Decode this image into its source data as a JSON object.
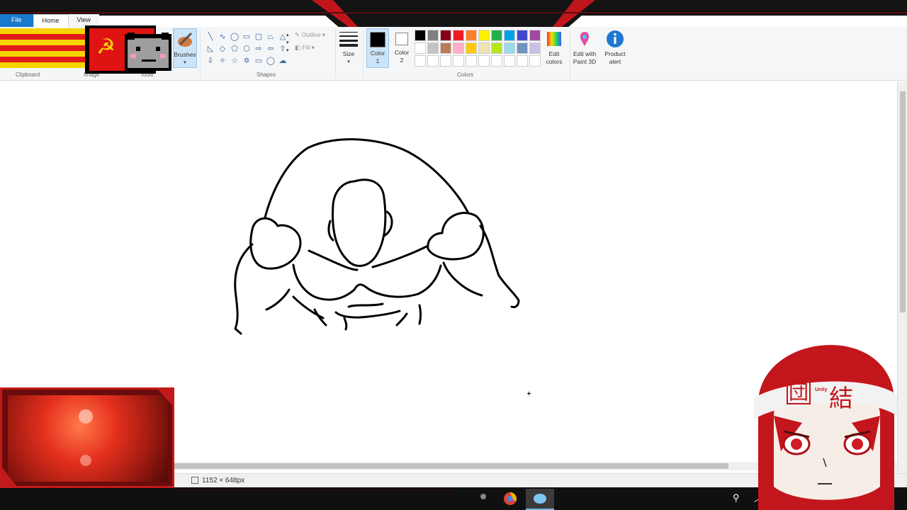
{
  "menu": {
    "file": "File",
    "home": "Home",
    "view": "View"
  },
  "ribbon": {
    "clipboard_label": "Clipboard",
    "image_label": "Image",
    "tools_label": "Tools",
    "brushes_label": "Brushes",
    "shapes_label": "Shapes",
    "outline_label": "Outline",
    "fill_label": "Fill",
    "size_label": "Size",
    "color1_label_a": "Color",
    "color1_label_b": "1",
    "color2_label_a": "Color",
    "color2_label_b": "2",
    "colors_label": "Colors",
    "edit_colors_a": "Edit",
    "edit_colors_b": "colors",
    "edit_3d_a": "Edit with",
    "edit_3d_b": "Paint 3D",
    "product_alert_a": "Product",
    "product_alert_b": "alert"
  },
  "palette": [
    "#000000",
    "#7f7f7f",
    "#880015",
    "#ed1c24",
    "#ff7f27",
    "#fff200",
    "#22b14c",
    "#00a2e8",
    "#3f48cc",
    "#a349a4",
    "#ffffff",
    "#c3c3c3",
    "#b97a57",
    "#ffaec9",
    "#ffc90e",
    "#efe4b0",
    "#b5e61d",
    "#99d9ea",
    "#7092be",
    "#c8bfe7"
  ],
  "color1": "#000000",
  "color2": "#ffffff",
  "status": {
    "dimensions": "1152 × 648px"
  },
  "avatar": {
    "headband_left": "団",
    "headband_small": "Unity",
    "headband_right": "結"
  },
  "icons": {
    "brush": "brush-icon",
    "paint3d": "paint3d-icon",
    "info": "info-icon",
    "search": "cortana-icon"
  }
}
